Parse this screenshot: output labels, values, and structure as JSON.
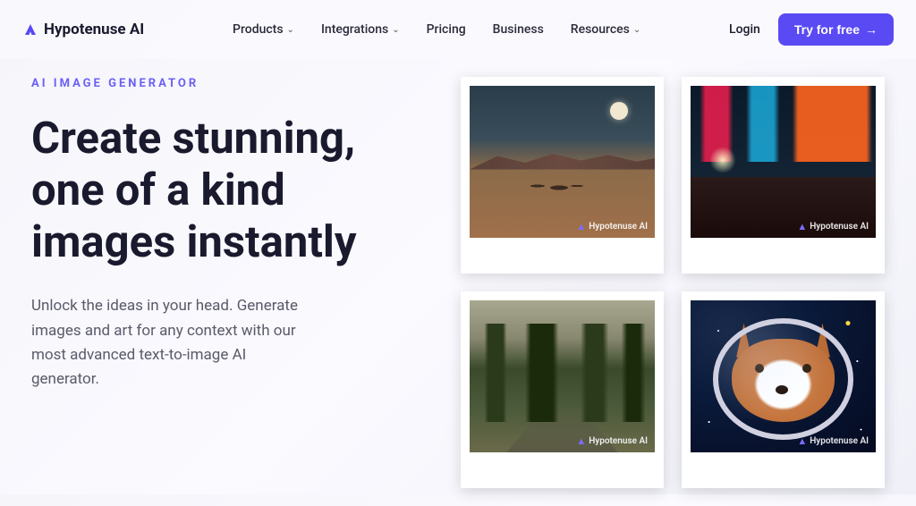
{
  "brand": {
    "name": "Hypotenuse AI"
  },
  "nav": {
    "items": [
      {
        "label": "Products",
        "has_dropdown": true
      },
      {
        "label": "Integrations",
        "has_dropdown": true
      },
      {
        "label": "Pricing",
        "has_dropdown": false
      },
      {
        "label": "Business",
        "has_dropdown": false
      },
      {
        "label": "Resources",
        "has_dropdown": true
      }
    ]
  },
  "header": {
    "login": "Login",
    "cta": "Try for free"
  },
  "hero": {
    "eyebrow": "AI IMAGE GENERATOR",
    "headline": "Create stunning, one of a kind images instantly",
    "subtext": "Unlock the ideas in your head. Generate images and art for any context with our most advanced text-to-image AI generator."
  },
  "gallery": {
    "watermark": "Hypotenuse AI",
    "images": [
      {
        "alt": "desert-moonlight-scene"
      },
      {
        "alt": "neon-street-bar"
      },
      {
        "alt": "forest-painting-deer"
      },
      {
        "alt": "corgi-astronaut"
      }
    ]
  },
  "colors": {
    "accent": "#5a4af4",
    "eyebrow": "#6b5ff5"
  }
}
